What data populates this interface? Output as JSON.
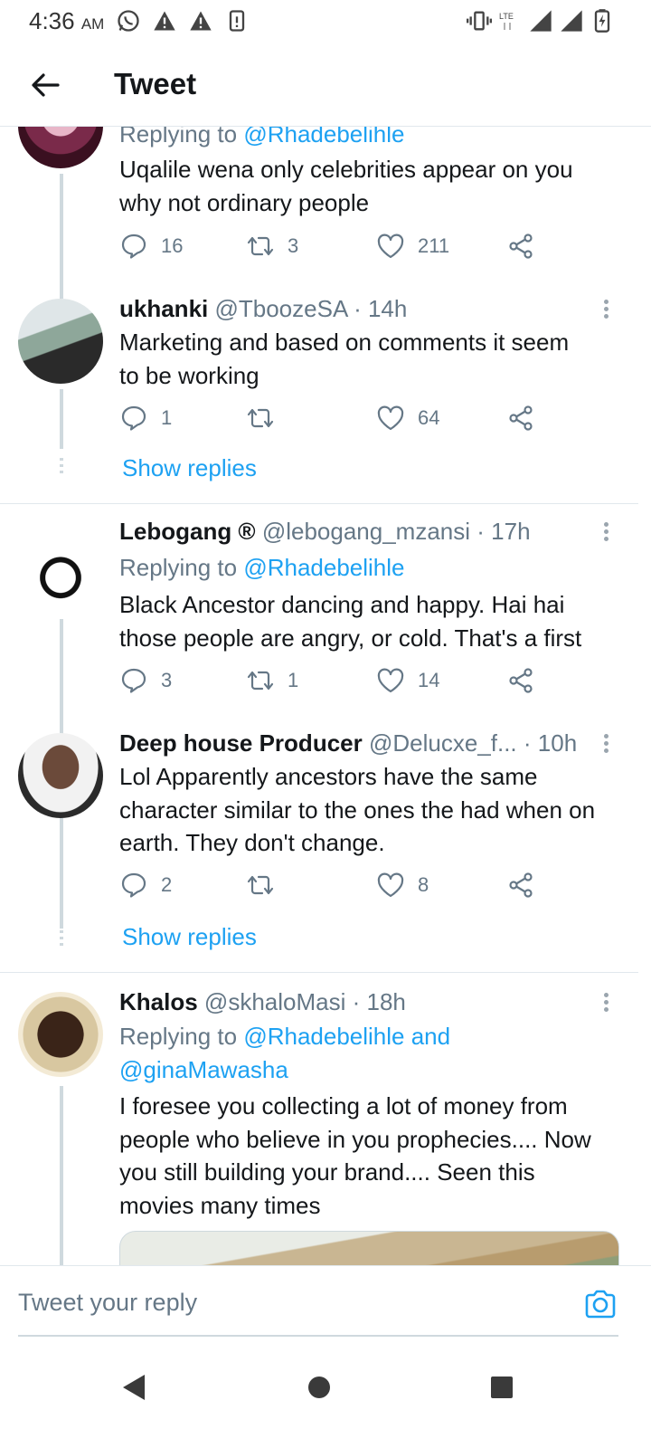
{
  "status_bar": {
    "time": "4:36",
    "ampm": "AM",
    "network_label": "LTE",
    "left_icons": [
      "whatsapp-icon",
      "alert-icon",
      "alert-icon",
      "sim-icon"
    ],
    "right_icons": [
      "vibrate-icon",
      "lte-icon",
      "signal-icon",
      "signal-icon",
      "battery-charging-icon"
    ]
  },
  "header": {
    "back_icon": "arrow-left-icon",
    "title": "Tweet"
  },
  "tweets": [
    {
      "name": "",
      "handle": "",
      "time": "",
      "reply_label": "Replying to",
      "reply_mentions": "@Rhadebelihle",
      "text_lines": [
        "Uqalile wena only celebrities appear on you",
        "why not ordinary people"
      ],
      "replies": "16",
      "retweets": "3",
      "likes": "211"
    },
    {
      "name": "ukhanki",
      "handle": "@TboozeSA",
      "time": "· 14h",
      "text_lines": [
        "Marketing and based on comments it seem",
        "to be working"
      ],
      "replies": "1",
      "retweets": "",
      "likes": "64",
      "show_replies": "Show replies"
    },
    {
      "name": "Lebogang ®",
      "handle": "@lebogang_mzansi",
      "time": "· 17h",
      "reply_label": "Replying to",
      "reply_mentions": "@Rhadebelihle",
      "text_lines": [
        "Black Ancestor dancing and happy. Hai hai",
        "those people are angry, or cold. That's a first"
      ],
      "replies": "3",
      "retweets": "1",
      "likes": "14"
    },
    {
      "name": "Deep house Producer",
      "handle": "@Delucxe_f...",
      "time": "· 10h",
      "text_lines": [
        "Lol Apparently ancestors have the same",
        "character similar to the ones the had when on",
        "earth. They don't change."
      ],
      "replies": "2",
      "retweets": "",
      "likes": "8",
      "show_replies": "Show replies"
    },
    {
      "name": "Khalos",
      "handle": "@skhaloMasi",
      "time": "· 18h",
      "reply_label": "Replying to",
      "reply_mentions_line1": "@Rhadebelihle and",
      "reply_mentions_line2": "@ginaMawasha",
      "text_lines": [
        "I foresee you collecting a lot of money from",
        "people who believe in you prophecies.... Now",
        "you still building your brand.... Seen this",
        "movies many times"
      ]
    }
  ],
  "reply_bar": {
    "placeholder": "Tweet your reply",
    "camera_icon": "camera-icon"
  },
  "nav_bar": {
    "icons": [
      "nav-back-icon",
      "nav-home-icon",
      "nav-recents-icon"
    ]
  },
  "colors": {
    "accent": "#1da1f2",
    "text": "#14171a",
    "secondary": "#657786",
    "divider": "#e1e8ed"
  }
}
